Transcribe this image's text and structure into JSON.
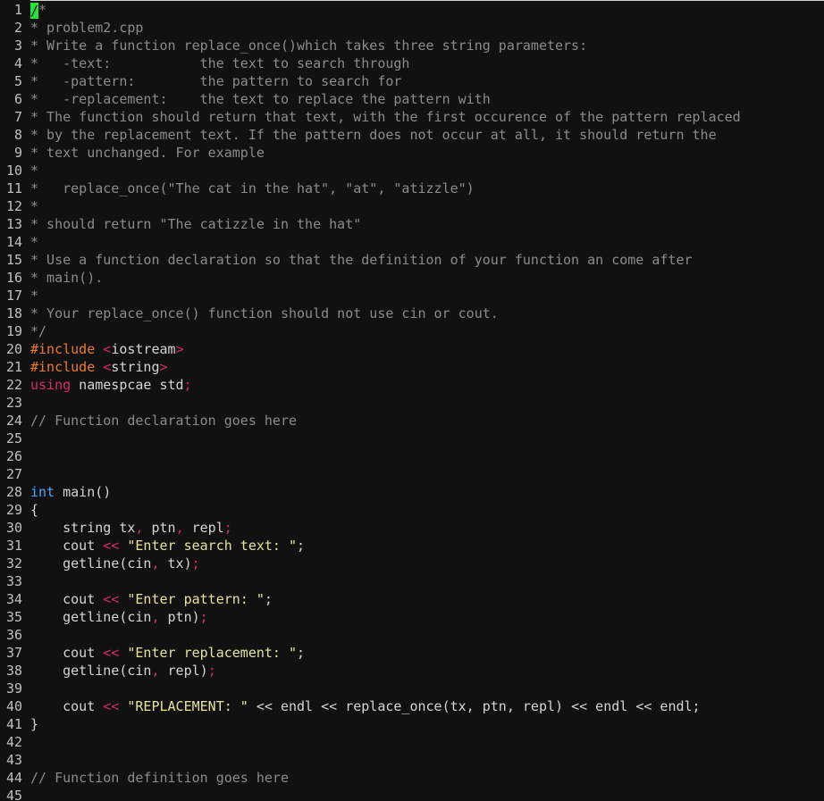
{
  "editor": {
    "colors": {
      "background": "#111111",
      "line_number": "#c0c0c0",
      "comment": "#8b8b8b",
      "preprocessor": "#f07a2c",
      "keyword": "#4fa3ff",
      "string": "#e6e29c",
      "operator": "#d72f62",
      "plain": "#d4d4d4",
      "cursor": "#22e336"
    },
    "cursor": {
      "line": 1,
      "column": 1
    },
    "lines": [
      {
        "n": "1",
        "tokens": [
          {
            "t": "/",
            "c": "cursor"
          },
          {
            "t": "*",
            "c": "comment"
          }
        ]
      },
      {
        "n": "2",
        "tokens": [
          {
            "t": "* problem2.cpp",
            "c": "comment"
          }
        ]
      },
      {
        "n": "3",
        "tokens": [
          {
            "t": "* Write a function replace_once()which takes three string parameters:",
            "c": "comment"
          }
        ]
      },
      {
        "n": "4",
        "tokens": [
          {
            "t": "*   -text:           the text to search through",
            "c": "comment"
          }
        ]
      },
      {
        "n": "5",
        "tokens": [
          {
            "t": "*   -pattern:        the pattern to search for",
            "c": "comment"
          }
        ]
      },
      {
        "n": "6",
        "tokens": [
          {
            "t": "*   -replacement:    the text to replace the pattern with",
            "c": "comment"
          }
        ]
      },
      {
        "n": "7",
        "tokens": [
          {
            "t": "* The function should return that text, with the first occurence of the pattern replaced",
            "c": "comment"
          }
        ]
      },
      {
        "n": "8",
        "tokens": [
          {
            "t": "* by the replacement text. If the pattern does not occur at all, it should return the",
            "c": "comment"
          }
        ]
      },
      {
        "n": "9",
        "tokens": [
          {
            "t": "* text unchanged. For example",
            "c": "comment"
          }
        ]
      },
      {
        "n": "10",
        "tokens": [
          {
            "t": "*",
            "c": "comment"
          }
        ]
      },
      {
        "n": "11",
        "tokens": [
          {
            "t": "*   replace_once(\"The cat in the hat\", \"at\", \"atizzle\")",
            "c": "comment"
          }
        ]
      },
      {
        "n": "12",
        "tokens": [
          {
            "t": "*",
            "c": "comment"
          }
        ]
      },
      {
        "n": "13",
        "tokens": [
          {
            "t": "* should return \"The catizzle in the hat\"",
            "c": "comment"
          }
        ]
      },
      {
        "n": "14",
        "tokens": [
          {
            "t": "*",
            "c": "comment"
          }
        ]
      },
      {
        "n": "15",
        "tokens": [
          {
            "t": "* Use a function declaration so that the definition of your function an come after",
            "c": "comment"
          }
        ]
      },
      {
        "n": "16",
        "tokens": [
          {
            "t": "* main().",
            "c": "comment"
          }
        ]
      },
      {
        "n": "17",
        "tokens": [
          {
            "t": "*",
            "c": "comment"
          }
        ]
      },
      {
        "n": "18",
        "tokens": [
          {
            "t": "* Your replace_once() function should not use cin or cout.",
            "c": "comment"
          }
        ]
      },
      {
        "n": "19",
        "tokens": [
          {
            "t": "*/",
            "c": "comment"
          }
        ]
      },
      {
        "n": "20",
        "tokens": [
          {
            "t": "#include ",
            "c": "pre"
          },
          {
            "t": "<",
            "c": "op"
          },
          {
            "t": "iostream",
            "c": "plain"
          },
          {
            "t": ">",
            "c": "op"
          }
        ]
      },
      {
        "n": "21",
        "tokens": [
          {
            "t": "#include ",
            "c": "pre"
          },
          {
            "t": "<",
            "c": "op"
          },
          {
            "t": "string",
            "c": "plain"
          },
          {
            "t": ">",
            "c": "op"
          }
        ]
      },
      {
        "n": "22",
        "tokens": [
          {
            "t": "using",
            "c": "op"
          },
          {
            "t": " namespcae std",
            "c": "plain"
          },
          {
            "t": ";",
            "c": "op"
          }
        ]
      },
      {
        "n": "23",
        "tokens": []
      },
      {
        "n": "24",
        "tokens": [
          {
            "t": "// Function declaration goes here",
            "c": "comment"
          }
        ]
      },
      {
        "n": "25",
        "tokens": []
      },
      {
        "n": "26",
        "tokens": []
      },
      {
        "n": "27",
        "tokens": []
      },
      {
        "n": "28",
        "tokens": [
          {
            "t": "int",
            "c": "kw"
          },
          {
            "t": " main()",
            "c": "plain"
          }
        ]
      },
      {
        "n": "29",
        "tokens": [
          {
            "t": "{",
            "c": "plain"
          }
        ]
      },
      {
        "n": "30",
        "tokens": [
          {
            "t": "    string tx",
            "c": "plain"
          },
          {
            "t": ",",
            "c": "op"
          },
          {
            "t": " ptn",
            "c": "plain"
          },
          {
            "t": ",",
            "c": "op"
          },
          {
            "t": " repl",
            "c": "plain"
          },
          {
            "t": ";",
            "c": "op"
          }
        ]
      },
      {
        "n": "31",
        "tokens": [
          {
            "t": "    cout ",
            "c": "plain"
          },
          {
            "t": "<<",
            "c": "op"
          },
          {
            "t": " ",
            "c": "plain"
          },
          {
            "t": "\"Enter search text: \"",
            "c": "str"
          },
          {
            "t": ";",
            "c": "plain"
          }
        ]
      },
      {
        "n": "32",
        "tokens": [
          {
            "t": "    getline(cin",
            "c": "plain"
          },
          {
            "t": ",",
            "c": "op"
          },
          {
            "t": " tx)",
            "c": "plain"
          },
          {
            "t": ";",
            "c": "op"
          }
        ]
      },
      {
        "n": "33",
        "tokens": []
      },
      {
        "n": "34",
        "tokens": [
          {
            "t": "    cout ",
            "c": "plain"
          },
          {
            "t": "<<",
            "c": "op"
          },
          {
            "t": " ",
            "c": "plain"
          },
          {
            "t": "\"Enter pattern: \"",
            "c": "str"
          },
          {
            "t": ";",
            "c": "plain"
          }
        ]
      },
      {
        "n": "35",
        "tokens": [
          {
            "t": "    getline(cin",
            "c": "plain"
          },
          {
            "t": ",",
            "c": "op"
          },
          {
            "t": " ptn)",
            "c": "plain"
          },
          {
            "t": ";",
            "c": "op"
          }
        ]
      },
      {
        "n": "36",
        "tokens": []
      },
      {
        "n": "37",
        "tokens": [
          {
            "t": "    cout ",
            "c": "plain"
          },
          {
            "t": "<<",
            "c": "op"
          },
          {
            "t": " ",
            "c": "plain"
          },
          {
            "t": "\"Enter replacement: \"",
            "c": "str"
          },
          {
            "t": ";",
            "c": "plain"
          }
        ]
      },
      {
        "n": "38",
        "tokens": [
          {
            "t": "    getline(cin",
            "c": "plain"
          },
          {
            "t": ",",
            "c": "op"
          },
          {
            "t": " repl)",
            "c": "plain"
          },
          {
            "t": ";",
            "c": "op"
          }
        ]
      },
      {
        "n": "39",
        "tokens": []
      },
      {
        "n": "40",
        "tokens": [
          {
            "t": "    cout ",
            "c": "plain"
          },
          {
            "t": "<<",
            "c": "op"
          },
          {
            "t": " ",
            "c": "plain"
          },
          {
            "t": "\"REPLACEMENT: \"",
            "c": "str"
          },
          {
            "t": " << endl << replace_once(tx, ptn, repl) << endl << endl;",
            "c": "plain"
          }
        ]
      },
      {
        "n": "41",
        "tokens": [
          {
            "t": "}",
            "c": "plain"
          }
        ]
      },
      {
        "n": "42",
        "tokens": []
      },
      {
        "n": "43",
        "tokens": []
      },
      {
        "n": "44",
        "tokens": [
          {
            "t": "// Function definition goes here",
            "c": "comment"
          }
        ]
      },
      {
        "n": "45",
        "tokens": []
      }
    ]
  }
}
